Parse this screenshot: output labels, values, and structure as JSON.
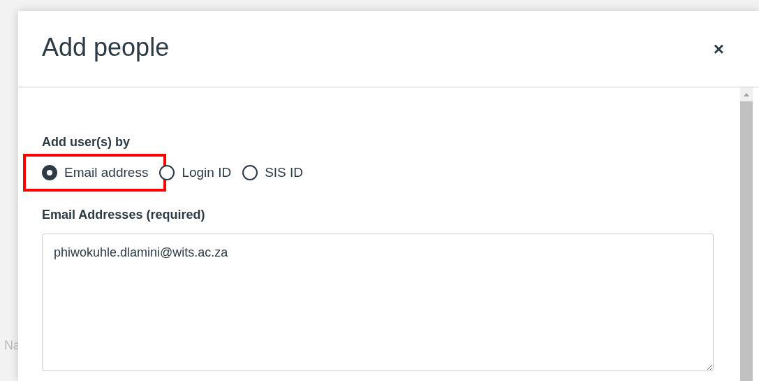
{
  "background": {
    "fragments": [
      "Na"
    ]
  },
  "dialog": {
    "title": "Add people",
    "close": "×",
    "add_by": {
      "label": "Add user(s) by",
      "options": [
        {
          "label": "Email address",
          "selected": true,
          "highlighted": true
        },
        {
          "label": "Login ID",
          "selected": false,
          "highlighted": false
        },
        {
          "label": "SIS ID",
          "selected": false,
          "highlighted": false
        }
      ]
    },
    "field": {
      "label": "Email Addresses (required)",
      "value": "phiwokuhle.dlamini@wits.ac.za"
    }
  }
}
